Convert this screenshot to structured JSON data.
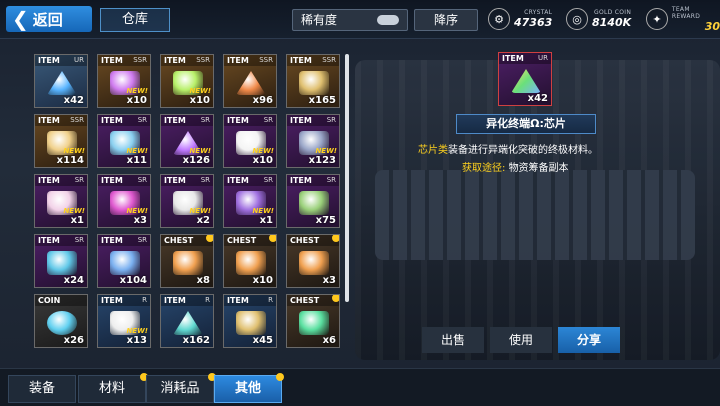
{
  "header": {
    "back_label": "返回",
    "title_tab": "仓库",
    "sort_label": "稀有度",
    "order_label": "降序",
    "resources": [
      {
        "name": "CRYSTAL",
        "value": "47363",
        "icon": "crystal-icon"
      },
      {
        "name": "GOLD COIN",
        "value": "8140K",
        "icon": "gold-coin-icon"
      },
      {
        "name": "TEAM REWARD",
        "value": "30",
        "icon": "team-reward-icon"
      }
    ]
  },
  "grid": {
    "items": [
      {
        "type": "ITEM",
        "rarity": "UR",
        "qty": "x42",
        "new": "",
        "color": "#58b4ff",
        "art": "prism-chip"
      },
      {
        "type": "ITEM",
        "rarity": "SSR",
        "qty": "x10",
        "new": "NEW!",
        "color": "#d07cf0",
        "art": "rod"
      },
      {
        "type": "ITEM",
        "rarity": "SSR",
        "qty": "x10",
        "new": "NEW!",
        "color": "#b8f06a",
        "art": "rod"
      },
      {
        "type": "ITEM",
        "rarity": "SSR",
        "qty": "x96",
        "new": "",
        "color": "#f08a4a",
        "art": "prism-chip"
      },
      {
        "type": "ITEM",
        "rarity": "SSR",
        "qty": "x165",
        "new": "",
        "color": "#e0c070",
        "art": "barrel"
      },
      {
        "type": "ITEM",
        "rarity": "SSR",
        "qty": "x114",
        "new": "NEW!",
        "color": "#f0d08a",
        "art": "tickets"
      },
      {
        "type": "ITEM",
        "rarity": "SR",
        "qty": "x11",
        "new": "NEW!",
        "color": "#8ad0f0",
        "art": "bottle"
      },
      {
        "type": "ITEM",
        "rarity": "SR",
        "qty": "x126",
        "new": "NEW!",
        "color": "#c07aff",
        "art": "prism-chip"
      },
      {
        "type": "ITEM",
        "rarity": "SR",
        "qty": "x10",
        "new": "NEW!",
        "color": "#f4f4f4",
        "art": "dice"
      },
      {
        "type": "ITEM",
        "rarity": "SR",
        "qty": "x123",
        "new": "NEW!",
        "color": "#9aa6c8",
        "art": "battery"
      },
      {
        "type": "ITEM",
        "rarity": "SR",
        "qty": "x1",
        "new": "NEW!",
        "color": "#f2d2e8",
        "art": "ice-cream"
      },
      {
        "type": "ITEM",
        "rarity": "SR",
        "qty": "x3",
        "new": "NEW!",
        "color": "#e05ad0",
        "art": "pendant"
      },
      {
        "type": "ITEM",
        "rarity": "SR",
        "qty": "x2",
        "new": "NEW!",
        "color": "#e8e8e8",
        "art": "feather"
      },
      {
        "type": "ITEM",
        "rarity": "SR",
        "qty": "x1",
        "new": "NEW!",
        "color": "#a070e0",
        "art": "book"
      },
      {
        "type": "ITEM",
        "rarity": "SR",
        "qty": "x75",
        "new": "",
        "color": "#9ad07a",
        "art": "barrel"
      },
      {
        "type": "ITEM",
        "rarity": "SR",
        "qty": "x24",
        "new": "",
        "color": "#60c8e8",
        "art": "bracelet"
      },
      {
        "type": "ITEM",
        "rarity": "SR",
        "qty": "x104",
        "new": "",
        "color": "#7ab0f0",
        "art": "tickets"
      },
      {
        "type": "CHEST",
        "rarity": "",
        "qty": "x8",
        "new": "",
        "color": "#f0a050",
        "art": "chest"
      },
      {
        "type": "CHEST",
        "rarity": "",
        "qty": "x10",
        "new": "",
        "color": "#f0a050",
        "art": "chest"
      },
      {
        "type": "CHEST",
        "rarity": "",
        "qty": "x3",
        "new": "",
        "color": "#f0a050",
        "art": "chest"
      },
      {
        "type": "COIN",
        "rarity": "",
        "qty": "x26",
        "new": "",
        "color": "#60d0f0",
        "art": "coin"
      },
      {
        "type": "ITEM",
        "rarity": "R",
        "qty": "x13",
        "new": "NEW!",
        "color": "#eeeeee",
        "art": "scroll"
      },
      {
        "type": "ITEM",
        "rarity": "R",
        "qty": "x162",
        "new": "",
        "color": "#60d8d0",
        "art": "prism-chip"
      },
      {
        "type": "ITEM",
        "rarity": "R",
        "qty": "x45",
        "new": "",
        "color": "#e0c070",
        "art": "barrel"
      },
      {
        "type": "CHEST",
        "rarity": "",
        "qty": "x6",
        "new": "",
        "color": "#5ae0a0",
        "art": "chest"
      }
    ]
  },
  "detail": {
    "type": "ITEM",
    "rarity": "UR",
    "qty": "x42",
    "name": "异化终端Ω:芯片",
    "desc_highlight": "芯片类",
    "desc_text": "装备进行异端化突破的终极材料。",
    "source_label": "获取途径:",
    "source_text": "物资筹备副本"
  },
  "actions": {
    "sell": "出售",
    "use": "使用",
    "share": "分享"
  },
  "tabs": [
    {
      "label": "装备",
      "dot": false,
      "active": false
    },
    {
      "label": "材料",
      "dot": true,
      "active": false
    },
    {
      "label": "消耗品",
      "dot": true,
      "active": false
    },
    {
      "label": "其他",
      "dot": true,
      "active": true
    }
  ]
}
